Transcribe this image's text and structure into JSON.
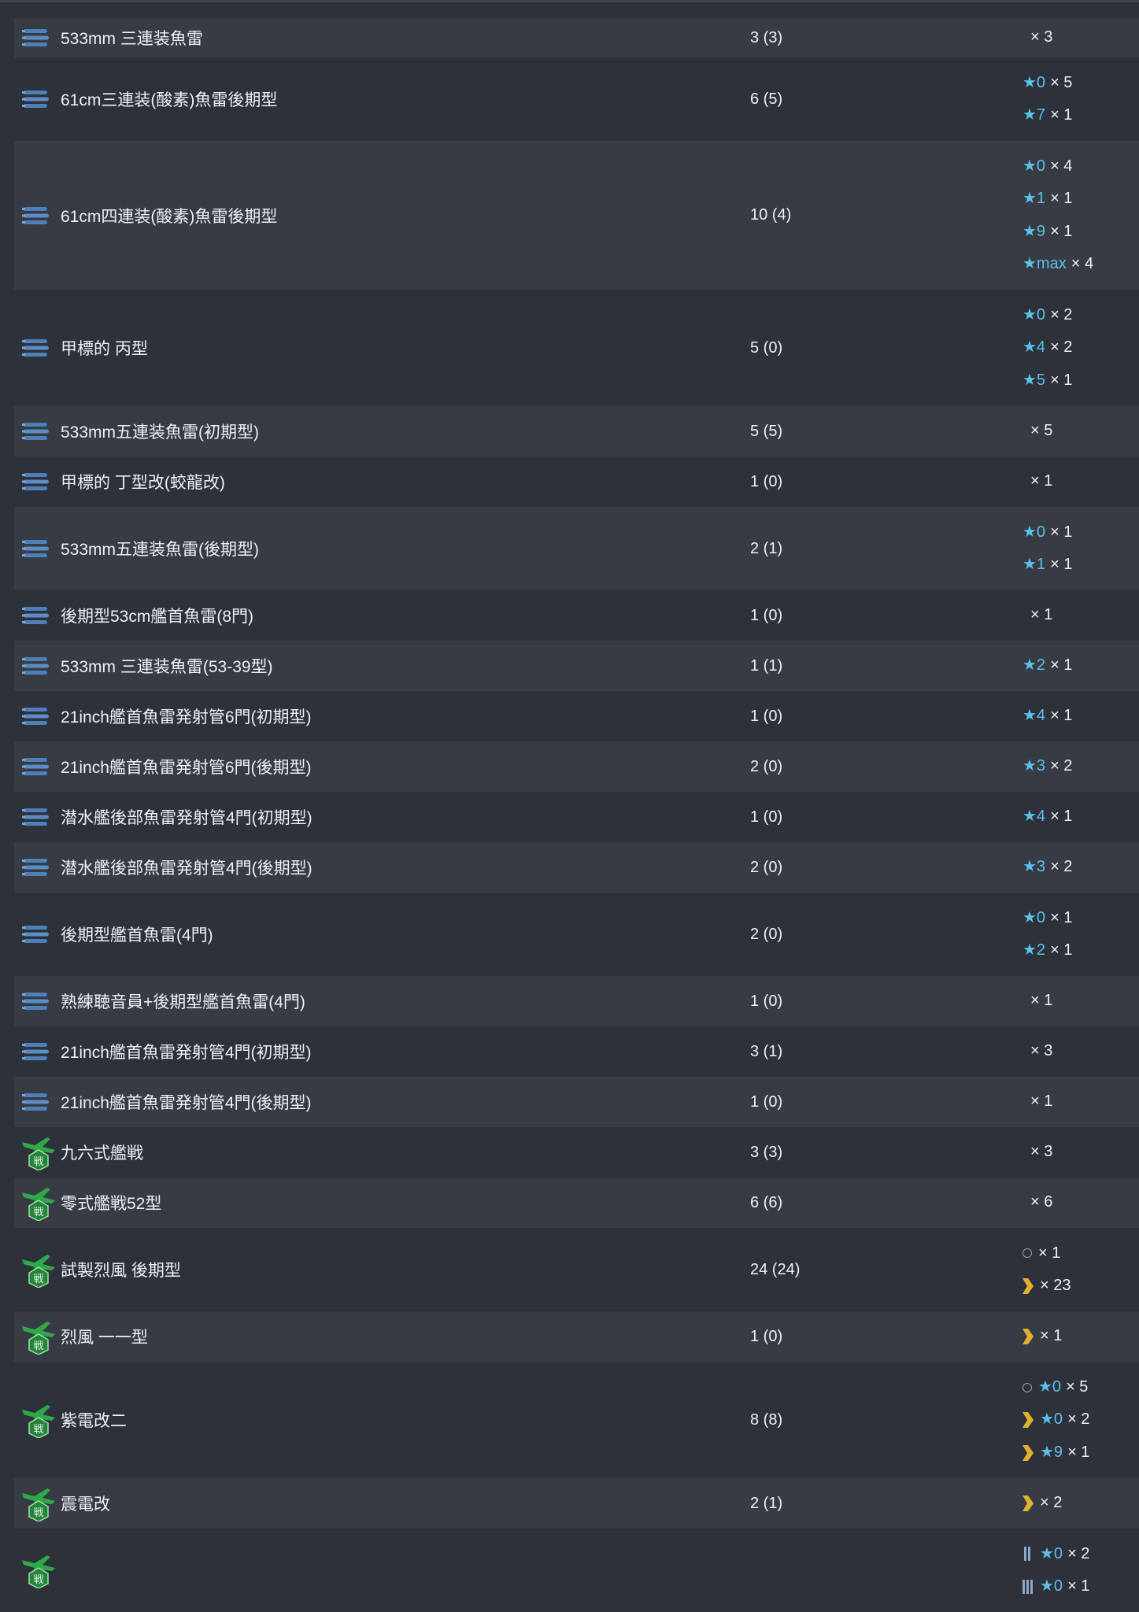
{
  "colors": {
    "background": "#2d3139",
    "row_alt": "#373c44",
    "star": "#5bc0eb",
    "proficiency": "#e0b030",
    "fighter_icon": "#2fa84a",
    "torpedo_icon": "#4e7fb8"
  },
  "rows": [
    {
      "icon": "torpedo-icon",
      "name": "533mm 三連装魚雷",
      "count": "3 (3)",
      "stats": [
        {
          "star": "",
          "proficiency": "",
          "mult": "× 3"
        }
      ]
    },
    {
      "icon": "torpedo-icon",
      "name": "61cm三連装(酸素)魚雷後期型",
      "count": "6 (5)",
      "stats": [
        {
          "star": "★0",
          "proficiency": "",
          "mult": "× 5"
        },
        {
          "star": "★7",
          "proficiency": "",
          "mult": "× 1"
        }
      ]
    },
    {
      "icon": "torpedo-icon",
      "name": "61cm四連装(酸素)魚雷後期型",
      "count": "10 (4)",
      "stats": [
        {
          "star": "★0",
          "proficiency": "",
          "mult": "× 4"
        },
        {
          "star": "★1",
          "proficiency": "",
          "mult": "× 1"
        },
        {
          "star": "★9",
          "proficiency": "",
          "mult": "× 1"
        },
        {
          "star": "★max",
          "proficiency": "",
          "mult": "× 4"
        }
      ]
    },
    {
      "icon": "torpedo-icon",
      "name": "甲標的 丙型",
      "count": "5 (0)",
      "stats": [
        {
          "star": "★0",
          "proficiency": "",
          "mult": "× 2"
        },
        {
          "star": "★4",
          "proficiency": "",
          "mult": "× 2"
        },
        {
          "star": "★5",
          "proficiency": "",
          "mult": "× 1"
        }
      ]
    },
    {
      "icon": "torpedo-icon",
      "name": "533mm五連装魚雷(初期型)",
      "count": "5 (5)",
      "stats": [
        {
          "star": "",
          "proficiency": "",
          "mult": "× 5"
        }
      ]
    },
    {
      "icon": "torpedo-icon",
      "name": "甲標的 丁型改(蛟龍改)",
      "count": "1 (0)",
      "stats": [
        {
          "star": "",
          "proficiency": "",
          "mult": "× 1"
        }
      ]
    },
    {
      "icon": "torpedo-icon",
      "name": "533mm五連装魚雷(後期型)",
      "count": "2 (1)",
      "stats": [
        {
          "star": "★0",
          "proficiency": "",
          "mult": "× 1"
        },
        {
          "star": "★1",
          "proficiency": "",
          "mult": "× 1"
        }
      ]
    },
    {
      "icon": "torpedo-icon",
      "name": "後期型53cm艦首魚雷(8門)",
      "count": "1 (0)",
      "stats": [
        {
          "star": "",
          "proficiency": "",
          "mult": "× 1"
        }
      ]
    },
    {
      "icon": "torpedo-icon",
      "name": "533mm 三連装魚雷(53-39型)",
      "count": "1 (1)",
      "stats": [
        {
          "star": "★2",
          "proficiency": "",
          "mult": "× 1"
        }
      ]
    },
    {
      "icon": "torpedo-icon",
      "name": "21inch艦首魚雷発射管6門(初期型)",
      "count": "1 (0)",
      "stats": [
        {
          "star": "★4",
          "proficiency": "",
          "mult": "× 1"
        }
      ]
    },
    {
      "icon": "torpedo-icon",
      "name": "21inch艦首魚雷発射管6門(後期型)",
      "count": "2 (0)",
      "stats": [
        {
          "star": "★3",
          "proficiency": "",
          "mult": "× 2"
        }
      ]
    },
    {
      "icon": "torpedo-icon",
      "name": "潜水艦後部魚雷発射管4門(初期型)",
      "count": "1 (0)",
      "stats": [
        {
          "star": "★4",
          "proficiency": "",
          "mult": "× 1"
        }
      ]
    },
    {
      "icon": "torpedo-icon",
      "name": "潜水艦後部魚雷発射管4門(後期型)",
      "count": "2 (0)",
      "stats": [
        {
          "star": "★3",
          "proficiency": "",
          "mult": "× 2"
        }
      ]
    },
    {
      "icon": "torpedo-icon",
      "name": "後期型艦首魚雷(4門)",
      "count": "2 (0)",
      "stats": [
        {
          "star": "★0",
          "proficiency": "",
          "mult": "× 1"
        },
        {
          "star": "★2",
          "proficiency": "",
          "mult": "× 1"
        }
      ]
    },
    {
      "icon": "torpedo-icon",
      "name": "熟練聴音員+後期型艦首魚雷(4門)",
      "count": "1 (0)",
      "stats": [
        {
          "star": "",
          "proficiency": "",
          "mult": "× 1"
        }
      ]
    },
    {
      "icon": "torpedo-icon",
      "name": "21inch艦首魚雷発射管4門(初期型)",
      "count": "3 (1)",
      "stats": [
        {
          "star": "",
          "proficiency": "",
          "mult": "× 3"
        }
      ]
    },
    {
      "icon": "torpedo-icon",
      "name": "21inch艦首魚雷発射管4門(後期型)",
      "count": "1 (0)",
      "stats": [
        {
          "star": "",
          "proficiency": "",
          "mult": "× 1"
        }
      ]
    },
    {
      "icon": "fighter-icon",
      "name": "九六式艦戦",
      "count": "3 (3)",
      "stats": [
        {
          "star": "",
          "proficiency": "",
          "mult": "× 3"
        }
      ]
    },
    {
      "icon": "fighter-icon",
      "name": "零式艦戦52型",
      "count": "6 (6)",
      "stats": [
        {
          "star": "",
          "proficiency": "",
          "mult": "× 6"
        }
      ]
    },
    {
      "icon": "fighter-icon",
      "name": "試製烈風 後期型",
      "count": "24 (24)",
      "stats": [
        {
          "star": "",
          "proficiency": "ring",
          "mult": "× 1"
        },
        {
          "star": "",
          "proficiency": "chevron",
          "mult": "× 23"
        }
      ]
    },
    {
      "icon": "fighter-icon",
      "name": "烈風 一一型",
      "count": "1 (0)",
      "stats": [
        {
          "star": "",
          "proficiency": "chevron",
          "mult": "× 1"
        }
      ]
    },
    {
      "icon": "fighter-icon",
      "name": "紫電改二",
      "count": "8 (8)",
      "stats": [
        {
          "star": "★0",
          "proficiency": "ring",
          "mult": "× 5"
        },
        {
          "star": "★0",
          "proficiency": "chevron",
          "mult": "× 2"
        },
        {
          "star": "★9",
          "proficiency": "chevron",
          "mult": "× 1"
        }
      ]
    },
    {
      "icon": "fighter-icon",
      "name": "震電改",
      "count": "2 (1)",
      "stats": [
        {
          "star": "",
          "proficiency": "chevron",
          "mult": "× 2"
        }
      ]
    },
    {
      "icon": "fighter-icon",
      "name": "",
      "count": "",
      "stats": [
        {
          "star": "★0",
          "proficiency": "bars2",
          "mult": "× 2"
        },
        {
          "star": "★0",
          "proficiency": "bars3",
          "mult": "× 1"
        }
      ]
    }
  ]
}
